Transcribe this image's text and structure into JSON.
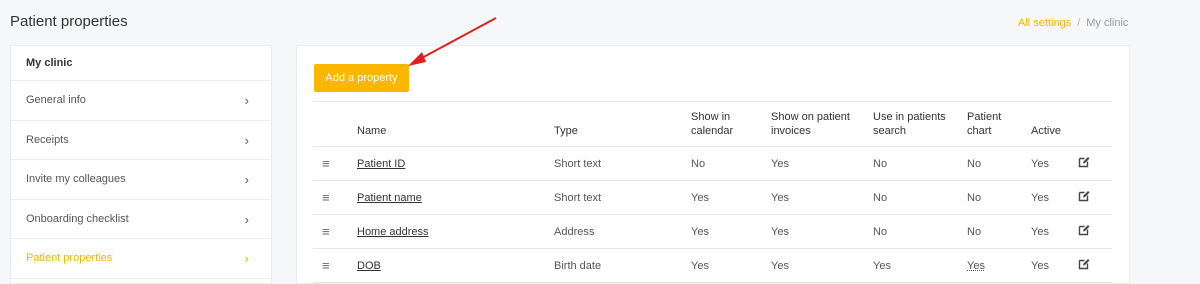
{
  "page_title": "Patient properties",
  "breadcrumb": {
    "link": "All settings",
    "separator": "/",
    "current": "My clinic"
  },
  "sidebar": {
    "header": "My clinic",
    "items": [
      {
        "label": "General info"
      },
      {
        "label": "Receipts"
      },
      {
        "label": "Invite my colleagues"
      },
      {
        "label": "Onboarding checklist"
      },
      {
        "label": "Patient properties"
      }
    ],
    "chevron": "›"
  },
  "main": {
    "add_button_label": "Add a property",
    "table": {
      "headers": [
        "Name",
        "Type",
        "Show in\ncalendar",
        "Show on patient\ninvoices",
        "Use in patients\nsearch",
        "Patient\nchart",
        "Active"
      ],
      "rows": [
        {
          "name": "Patient ID",
          "type": "Short text",
          "calendar": "No",
          "invoices": "Yes",
          "search": "No",
          "chart": "No",
          "active": "Yes"
        },
        {
          "name": "Patient name",
          "type": "Short text",
          "calendar": "Yes",
          "invoices": "Yes",
          "search": "No",
          "chart": "No",
          "active": "Yes"
        },
        {
          "name": "Home address",
          "type": "Address",
          "calendar": "Yes",
          "invoices": "Yes",
          "search": "No",
          "chart": "No",
          "active": "Yes"
        },
        {
          "name": "DOB",
          "type": "Birth date",
          "calendar": "Yes",
          "invoices": "Yes",
          "search": "Yes",
          "chart": "Yes",
          "active": "Yes"
        }
      ]
    }
  },
  "icons": {
    "drag": "drag-handle-icon",
    "edit": "edit-icon",
    "arrow": "annotation-arrow"
  },
  "colors": {
    "accent": "#fbb700",
    "arrow": "#e02020"
  }
}
